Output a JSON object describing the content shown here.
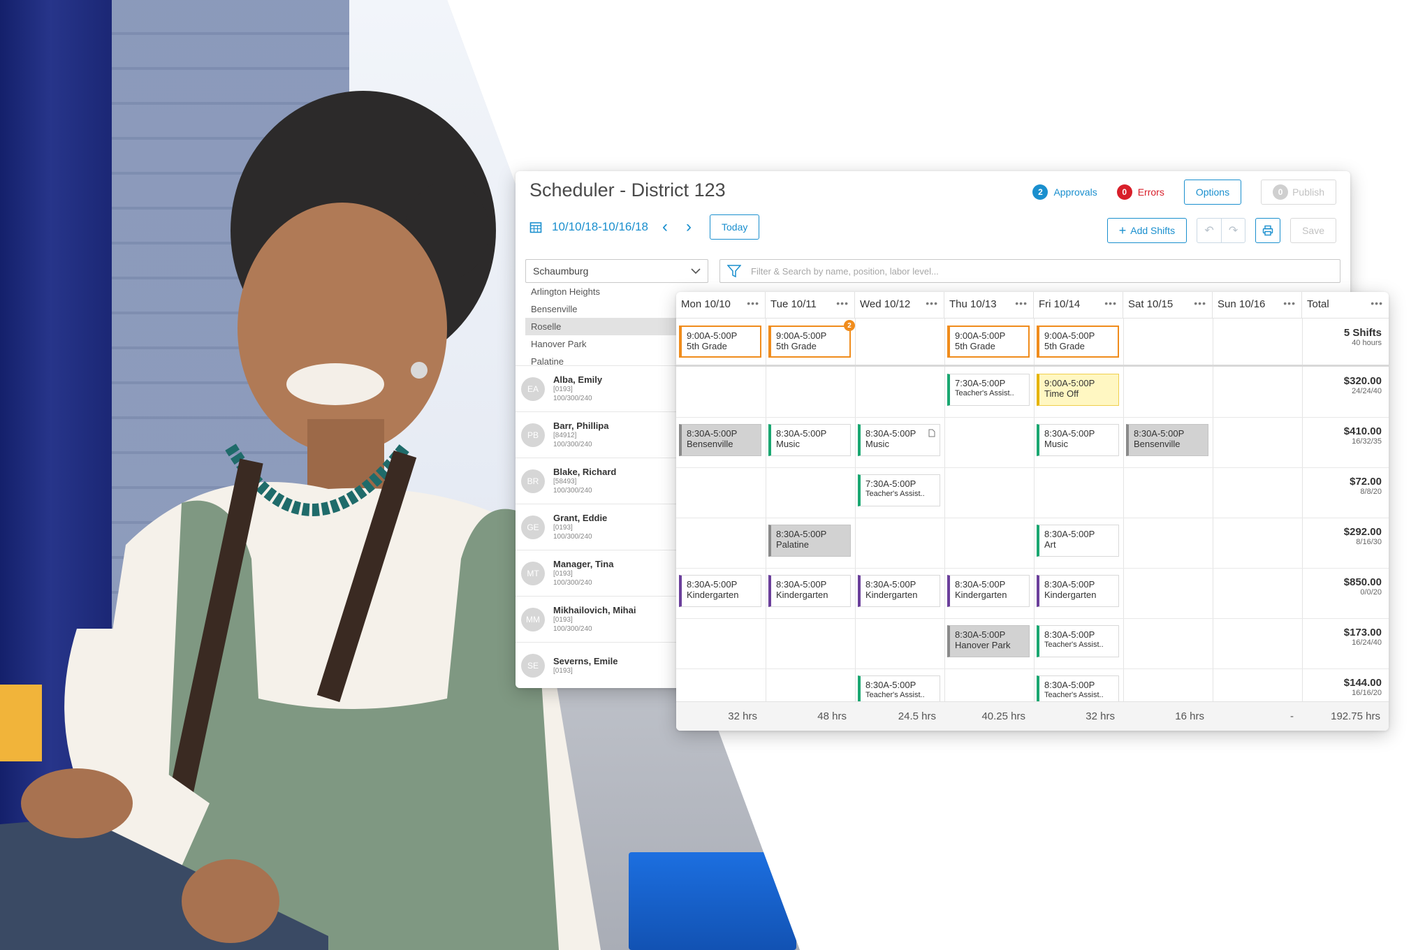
{
  "app": {
    "title": "Scheduler - District 123",
    "approvals": {
      "count": "2",
      "label": "Approvals"
    },
    "errors": {
      "count": "0",
      "label": "Errors"
    },
    "options_label": "Options",
    "publish": {
      "count": "0",
      "label": "Publish"
    }
  },
  "toolbar": {
    "date_range": "10/10/18-10/16/18",
    "today_label": "Today",
    "add_shifts_label": "Add Shifts",
    "save_label": "Save"
  },
  "location": {
    "selected": "Schaumburg",
    "options": [
      "Arlington Heights",
      "Bensenville",
      "Roselle",
      "Hanover Park",
      "Palatine"
    ],
    "highlighted": "Roselle"
  },
  "filter": {
    "placeholder": "Filter & Search by name, position, labor level..."
  },
  "employees": [
    {
      "initials": "EA",
      "name": "Alba, Emily",
      "id": "[0193]",
      "hours": "100/300/240"
    },
    {
      "initials": "PB",
      "name": "Barr, Phillipa",
      "id": "[84912]",
      "hours": "100/300/240"
    },
    {
      "initials": "BR",
      "name": "Blake, Richard",
      "id": "[58493]",
      "hours": "100/300/240"
    },
    {
      "initials": "GE",
      "name": "Grant, Eddie",
      "id": "[0193]",
      "hours": "100/300/240"
    },
    {
      "initials": "MT",
      "name": "Manager, Tina",
      "id": "[0193]",
      "hours": "100/300/240"
    },
    {
      "initials": "MM",
      "name": "Mikhailovich, Mihai",
      "id": "[0193]",
      "hours": "100/300/240"
    },
    {
      "initials": "SE",
      "name": "Severns, Emile",
      "id": "[0193]",
      "hours": ""
    }
  ],
  "week": {
    "days": [
      "Mon 10/10",
      "Tue 10/11",
      "Wed 10/12",
      "Thu 10/13",
      "Fri 10/14",
      "Sat 10/15",
      "Sun 10/16"
    ],
    "total_label": "Total",
    "more_glyph": "•••",
    "open_shifts": {
      "summary": "5 Shifts",
      "summary_hours": "40 hours",
      "items": [
        {
          "day": 0,
          "time": "9:00A-5:00P",
          "position": "5th Grade"
        },
        {
          "day": 1,
          "time": "9:00A-5:00P",
          "position": "5th Grade",
          "badge": "2"
        },
        {
          "day": 3,
          "time": "9:00A-5:00P",
          "position": "5th Grade"
        },
        {
          "day": 4,
          "time": "9:00A-5:00P",
          "position": "5th Grade"
        }
      ]
    },
    "rows": [
      {
        "total": "$320.00",
        "sub": "24/24/40",
        "shifts": [
          {
            "day": 3,
            "time": "7:30A-5:00P",
            "position": "Teacher's Assist..",
            "style": "green",
            "small": true
          },
          {
            "day": 4,
            "time": "9:00A-5:00P",
            "position": "Time Off",
            "style": "timeoff"
          }
        ]
      },
      {
        "total": "$410.00",
        "sub": "16/32/35",
        "shifts": [
          {
            "day": 0,
            "time": "8:30A-5:00P",
            "position": "Bensenville",
            "style": "grey"
          },
          {
            "day": 1,
            "time": "8:30A-5:00P",
            "position": "Music",
            "style": "green"
          },
          {
            "day": 2,
            "time": "8:30A-5:00P",
            "position": "Music",
            "style": "green",
            "doc": true
          },
          {
            "day": 4,
            "time": "8:30A-5:00P",
            "position": "Music",
            "style": "green"
          },
          {
            "day": 5,
            "time": "8:30A-5:00P",
            "position": "Bensenville",
            "style": "grey"
          }
        ]
      },
      {
        "total": "$72.00",
        "sub": "8/8/20",
        "shifts": [
          {
            "day": 2,
            "time": "7:30A-5:00P",
            "position": "Teacher's Assist..",
            "style": "green",
            "small": true
          }
        ]
      },
      {
        "total": "$292.00",
        "sub": "8/16/30",
        "shifts": [
          {
            "day": 1,
            "time": "8:30A-5:00P",
            "position": "Palatine",
            "style": "grey"
          },
          {
            "day": 4,
            "time": "8:30A-5:00P",
            "position": "Art",
            "style": "green"
          }
        ]
      },
      {
        "total": "$850.00",
        "sub": "0/0/20",
        "shifts": [
          {
            "day": 0,
            "time": "8:30A-5:00P",
            "position": "Kindergarten",
            "style": "purple"
          },
          {
            "day": 1,
            "time": "8:30A-5:00P",
            "position": "Kindergarten",
            "style": "purple"
          },
          {
            "day": 2,
            "time": "8:30A-5:00P",
            "position": "Kindergarten",
            "style": "purple"
          },
          {
            "day": 3,
            "time": "8:30A-5:00P",
            "position": "Kindergarten",
            "style": "purple"
          },
          {
            "day": 4,
            "time": "8:30A-5:00P",
            "position": "Kindergarten",
            "style": "purple"
          }
        ]
      },
      {
        "total": "$173.00",
        "sub": "16/24/40",
        "shifts": [
          {
            "day": 3,
            "time": "8:30A-5:00P",
            "position": "Hanover Park",
            "style": "grey"
          },
          {
            "day": 4,
            "time": "8:30A-5:00P",
            "position": "Teacher's Assist..",
            "style": "green",
            "small": true
          }
        ]
      },
      {
        "total": "$144.00",
        "sub": "16/16/20",
        "shifts": [
          {
            "day": 2,
            "time": "8:30A-5:00P",
            "position": "Teacher's Assist..",
            "style": "green",
            "small": true
          },
          {
            "day": 4,
            "time": "8:30A-5:00P",
            "position": "Teacher's Assist..",
            "style": "green",
            "small": true
          }
        ]
      }
    ],
    "day_totals": [
      "32 hrs",
      "48 hrs",
      "24.5 hrs",
      "40.25 hrs",
      "32 hrs",
      "16 hrs",
      "-",
      "192.75 hrs"
    ]
  },
  "colors": {
    "accent": "#1a8fce",
    "error": "#d81f2a",
    "open_shift": "#f08c1c",
    "assigned_green": "#1aa771",
    "assigned_purple": "#6b3f9b",
    "time_off": "#fff7c2"
  }
}
